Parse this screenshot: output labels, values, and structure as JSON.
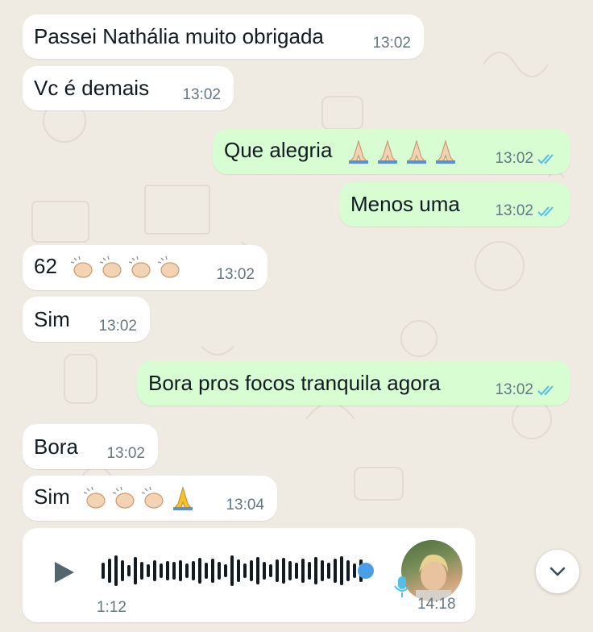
{
  "messages": [
    {
      "text": "Passei Nathália muito obrigada",
      "time": "13:02"
    },
    {
      "text": "Vc é demais",
      "time": "13:02"
    },
    {
      "text": "Que alegria",
      "time": "13:02"
    },
    {
      "text": "Menos uma",
      "time": "13:02"
    },
    {
      "text": "62",
      "time": "13:02"
    },
    {
      "text": "Sim",
      "time": "13:02"
    },
    {
      "text": "Bora pros focos tranquila agora",
      "time": "13:02"
    },
    {
      "text": "Bora",
      "time": "13:02"
    },
    {
      "text": "Sim",
      "time": "13:04"
    }
  ],
  "voice": {
    "duration": "1:12",
    "time": "14:18"
  },
  "colors": {
    "incoming": "#ffffff",
    "outgoing": "#d9fdd3",
    "read_ticks": "#53bdeb",
    "waveform_dot": "#4a9fe8"
  },
  "icons": {
    "play": "play-icon",
    "mic": "microphone-icon",
    "scroll": "chevron-down-icon",
    "read": "double-check-icon"
  }
}
